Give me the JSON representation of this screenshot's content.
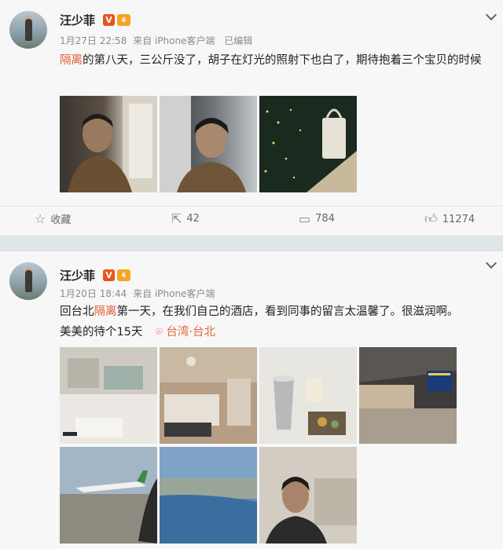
{
  "posts": [
    {
      "author": "汪少菲",
      "vip_badge": "V",
      "level_badge": "6",
      "time": "1月27日 22:58",
      "source": "来自 iPhone客户端",
      "edited": "已编辑",
      "text_highlight": "隔离",
      "text_rest": "的第八天，三公斤没了，胡子在灯光的照射下也白了，期待抱着三个宝贝的时候",
      "actions": {
        "favorite_icon": "star-icon",
        "favorite_label": "收藏",
        "repost_icon": "share-icon",
        "repost_count": "42",
        "comment_icon": "comment-icon",
        "comment_count": "784",
        "like_icon": "thumbs-up-icon",
        "like_count": "11274"
      }
    },
    {
      "author": "汪少菲",
      "vip_badge": "V",
      "level_badge": "6",
      "time": "1月20日 18:44",
      "source": "来自 iPhone客户端",
      "text_before": "回台北",
      "text_highlight": "隔离",
      "text_rest": "第一天，在我们自己的酒店，看到同事的留言太温馨了。很滋润啊。",
      "text_line2": "美美的待个15天",
      "location": "台湾·台北",
      "location_icon": "location-pin-icon"
    }
  ],
  "colors": {
    "accent_orange": "#e25b3a",
    "vip_badge": "#e8541e",
    "level_badge": "#f4a623",
    "separator": "#dfe6e8"
  }
}
